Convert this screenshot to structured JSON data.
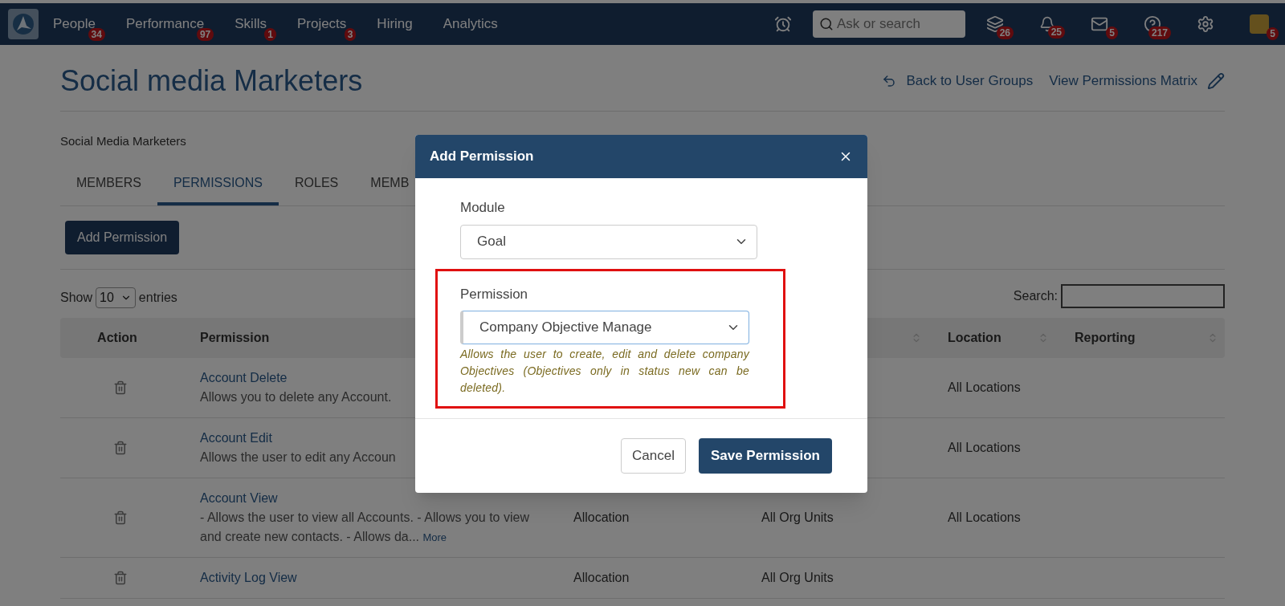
{
  "nav": {
    "items": [
      {
        "label": "People",
        "badge": "34"
      },
      {
        "label": "Performance",
        "badge": "97"
      },
      {
        "label": "Skills",
        "badge": "1"
      },
      {
        "label": "Projects",
        "badge": "3"
      },
      {
        "label": "Hiring"
      },
      {
        "label": "Analytics"
      }
    ],
    "search": {
      "placeholder": "Ask or search"
    },
    "icons": [
      {
        "kind": "stack",
        "badge": "26"
      },
      {
        "kind": "bell",
        "badge": "25"
      },
      {
        "kind": "mail",
        "badge": "5"
      },
      {
        "kind": "help",
        "badge": "217"
      },
      {
        "kind": "gear"
      },
      {
        "kind": "avatar",
        "badge": "5"
      }
    ]
  },
  "page": {
    "title": "Social media Marketers",
    "links": [
      "Back to User Groups",
      "View Permissions Matrix"
    ],
    "subtitle": "Social Media Marketers"
  },
  "tabs": [
    {
      "label": "MEMBERS",
      "selected": false
    },
    {
      "label": "PERMISSIONS",
      "selected": true
    },
    {
      "label": "ROLES",
      "selected": false
    },
    {
      "label": "MEMB",
      "selected": false
    }
  ],
  "add_button": "Add Permission",
  "length": {
    "before": "Show",
    "value": "10",
    "after": "entries"
  },
  "search_label": "Search:",
  "table": {
    "columns": [
      "Action",
      "Permission",
      "",
      "",
      "Location",
      "Reporting"
    ],
    "rows": [
      {
        "name": "Account Delete",
        "description": "Allows you to delete any Account.",
        "location": "All Locations"
      },
      {
        "name": "Account Edit",
        "description": "Allows the user to edit any Accoun",
        "location": "All Locations"
      },
      {
        "name": "Account View",
        "description": "- Allows the user to view all Accounts. - Allows you to view and create new contacts. - Allows da...",
        "more": "More",
        "type": "Allocation",
        "org": "All Org Units",
        "location": "All Locations"
      },
      {
        "name": "Activity Log View",
        "type": "Allocation",
        "org": "All Org Units"
      }
    ]
  },
  "dialog": {
    "title": "Add Permission",
    "module": {
      "label": "Module",
      "value": "Goal"
    },
    "permission": {
      "label": "Permission",
      "value": "Company Objective Manage",
      "help": "Allows the user to create, edit and delete company Objectives (Objectives only in status new can be deleted)."
    },
    "buttons": {
      "cancel": "Cancel",
      "save": "Save Permission"
    }
  }
}
